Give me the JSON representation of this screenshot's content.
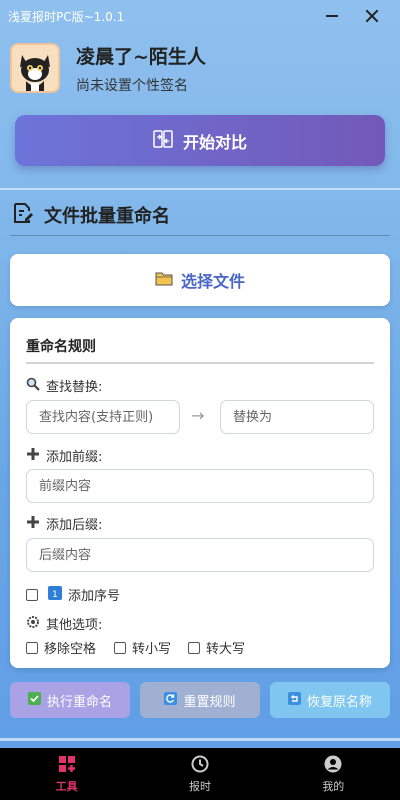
{
  "window": {
    "title": "浅夏报时PC版~1.0.1"
  },
  "profile": {
    "name": "凌晨了~陌生人",
    "signature": "尚未设置个性签名"
  },
  "compare_button": {
    "label": "开始对比"
  },
  "section": {
    "title": "文件批量重命名"
  },
  "select_file": {
    "label": "选择文件"
  },
  "rules": {
    "title": "重命名规则",
    "find_replace_label": "查找替换:",
    "find_placeholder": "查找内容(支持正则)",
    "replace_placeholder": "替换为",
    "arrow": "→",
    "prefix_label": "添加前缀:",
    "prefix_placeholder": "前缀内容",
    "suffix_label": "添加后缀:",
    "suffix_placeholder": "后缀内容",
    "add_index_label": "添加序号",
    "other_options_label": "其他选项:",
    "options": {
      "remove_spaces": "移除空格",
      "to_lower": "转小写",
      "to_upper": "转大写"
    }
  },
  "actions": {
    "execute": "执行重命名",
    "reset": "重置规则",
    "restore": "恢复原名称"
  },
  "tabs": [
    {
      "label": "工具",
      "icon": "toolbox-icon",
      "active": true
    },
    {
      "label": "报时",
      "icon": "clock-icon",
      "active": false
    },
    {
      "label": "我的",
      "icon": "user-icon",
      "active": false
    }
  ],
  "colors": {
    "accent_purple": "#6d74d9",
    "active_tab": "#e2336b",
    "link_blue": "#4a66c8"
  }
}
